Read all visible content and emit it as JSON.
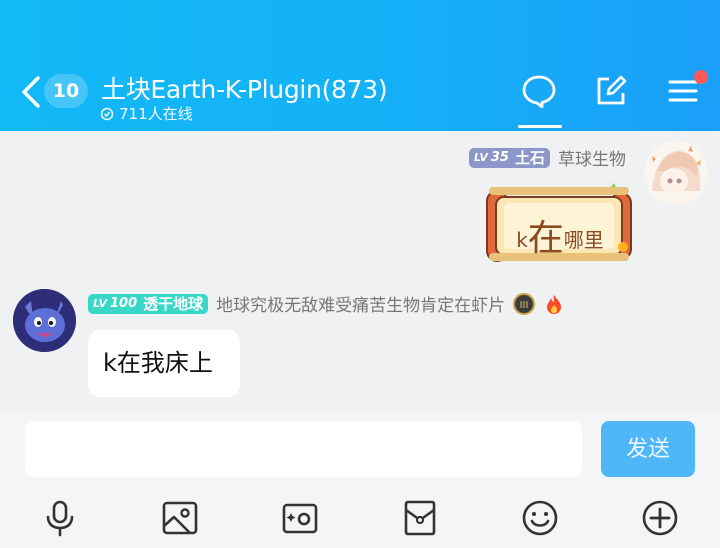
{
  "header": {
    "unread_count": "10",
    "group_title": "土块Earth-K-Plugin(873)",
    "online_text": "711人在线",
    "bg_color": "#13b8f6"
  },
  "messages": [
    {
      "side": "right",
      "level_prefix": "LV",
      "level_num": "35",
      "level_color": "#8d96c8",
      "nickname": "土石",
      "title": "草球生物",
      "sticker_k": "k",
      "sticker_big": "在",
      "sticker_small": "哪里"
    },
    {
      "side": "left",
      "level_prefix": "LV",
      "level_num": "100",
      "level_color": "#39d7c8",
      "nickname": "透干地球",
      "title": "地球究极无敌难受痛苦生物肯定在虾片",
      "text": "k在我床上"
    }
  ],
  "input": {
    "placeholder": "",
    "send_label": "发送"
  },
  "toolbar": {
    "icons": [
      "microphone-icon",
      "image-icon",
      "camera-icon",
      "red-packet-icon",
      "emoji-icon",
      "plus-icon"
    ]
  }
}
